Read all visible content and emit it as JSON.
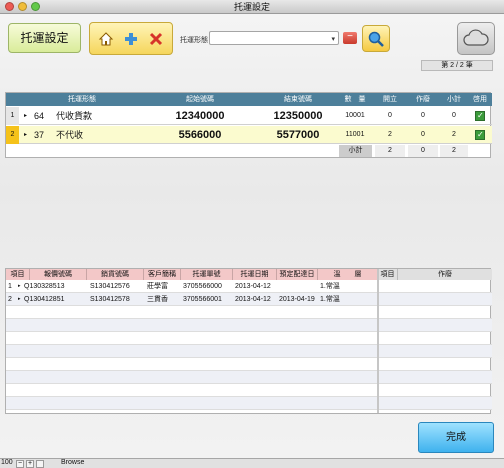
{
  "window": {
    "title": "托運設定"
  },
  "toolbar": {
    "title_button": "托運設定",
    "type_label": "托運形態",
    "type_value": ""
  },
  "page_indicator": "第 2 / 2 筆",
  "upper_table": {
    "headers": [
      "托運形態",
      "起始號碼",
      "結束號碼",
      "數　量",
      "開立",
      "作廢",
      "小計",
      "啓用"
    ],
    "rows": [
      {
        "num": "1",
        "code": "64",
        "name": "代收貨款",
        "start": "12340000",
        "end": "12350000",
        "qty": "10001",
        "issued": "0",
        "void": "0",
        "subtotal": "0",
        "enabled": true
      },
      {
        "num": "2",
        "code": "37",
        "name": "不代收",
        "start": "5566000",
        "end": "5577000",
        "qty": "11001",
        "issued": "2",
        "void": "0",
        "subtotal": "2",
        "enabled": true
      }
    ],
    "footer": {
      "label": "小計",
      "issued": "2",
      "void": "0",
      "subtotal": "2"
    }
  },
  "lower_table": {
    "headers": [
      "項目",
      "報價號碼",
      "銷貨號碼",
      "客戶簡稱",
      "托運單號",
      "托運日期",
      "預定配達日",
      "溫　　層"
    ],
    "rows": [
      {
        "num": "1",
        "quote": "Q130328513",
        "sales": "S130412576",
        "customer": "莊學富",
        "waybill": "3705566000",
        "date": "2013-04-12",
        "eta": "",
        "temp": "1.常溫"
      },
      {
        "num": "2",
        "quote": "Q130412851",
        "sales": "S130412578",
        "customer": "三貫香",
        "waybill": "3705566001",
        "date": "2013-04-12",
        "eta": "2013-04-19",
        "temp": "1.常溫"
      }
    ],
    "side_headers": [
      "項目",
      "作廢"
    ]
  },
  "done_button": "完成",
  "status": {
    "zoom": "100",
    "mode": "Browse"
  }
}
